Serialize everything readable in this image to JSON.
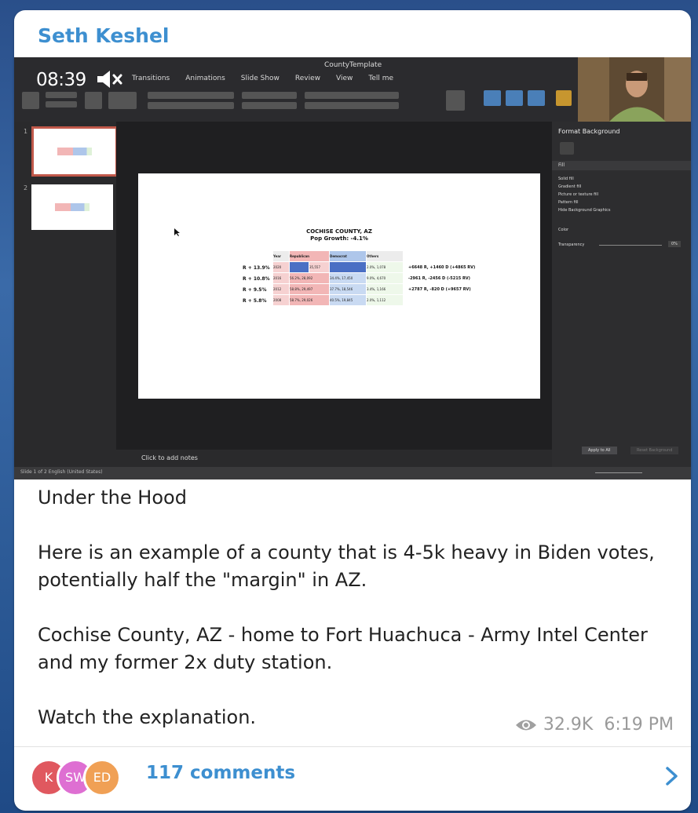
{
  "post": {
    "author": "Seth Keshel",
    "paragraphs": [
      "Under the Hood",
      "Here is an example of a county that is 4-5k heavy in Biden votes, potentially half the \"margin\" in AZ.",
      "Cochise County, AZ - home to Fort Huachuca - Army Intel Center and my former 2x duty station.",
      "Watch the explanation."
    ],
    "views": "32.9K",
    "time": "6:19 PM"
  },
  "video": {
    "timer": "08:39",
    "muted": true,
    "doc_title": "CountyTemplate",
    "tabs": [
      "Transitions",
      "Animations",
      "Slide Show",
      "Review",
      "View",
      "Tell me"
    ],
    "notes_placeholder": "Click to add notes",
    "status_text": "Slide 1 of 2   English (United States)",
    "format_pane": {
      "title": "Format Background",
      "section": "Fill",
      "options": [
        "Solid fill",
        "Gradient fill",
        "Picture or texture fill",
        "Pattern fill",
        "Hide Background Graphics"
      ],
      "color_label": "Color",
      "transparency_label": "Transparency",
      "transparency_value": "0%",
      "apply_all": "Apply to All",
      "reset": "Reset Background"
    },
    "slide": {
      "title": "COCHISE COUNTY, AZ",
      "subtitle": "Pop Growth: -4.1%",
      "headers": [
        "Year",
        "Republican",
        "Democrat",
        "Others"
      ],
      "row_labels": [
        "R + 13.9%",
        "R + 10.8%",
        "R + 9.5%",
        "R + 5.8%"
      ],
      "rows": [
        [
          "2020",
          "",
          "",
          "2.0%, 1,078"
        ],
        [
          "2016",
          "56.2%, 28,092",
          "34.4%, 17,450",
          "9.0%, 4,670"
        ],
        [
          "2012",
          "58.8%, 29,497",
          "37.7%, 18,546",
          "3.4%, 1,166"
        ],
        [
          "2008",
          "58.7%, 29,026",
          "40.5%, 19,845",
          "2.0%, 1,112"
        ]
      ],
      "partial_value": "35,557",
      "notes": [
        "+6648 R, +1460 D (+4865 RV)",
        "-2961 R, -2456 D (-5215 RV)",
        "+2787 R, -820 D (+9657 RV)"
      ]
    }
  },
  "comments": {
    "count_label": "117 comments",
    "avatars": [
      {
        "initials": "K",
        "color": "#e0585f"
      },
      {
        "initials": "SW",
        "color": "#de6fd2"
      },
      {
        "initials": "ED",
        "color": "#f0a055"
      }
    ]
  },
  "colors": {
    "accent": "#3d8fd0",
    "card": "#ffffff",
    "republican": "#f2b6b6",
    "democrat": "#aec6ea",
    "others": "#dff1d8"
  },
  "icons": [
    "mute-icon",
    "eye-icon",
    "chevron-right-icon"
  ]
}
